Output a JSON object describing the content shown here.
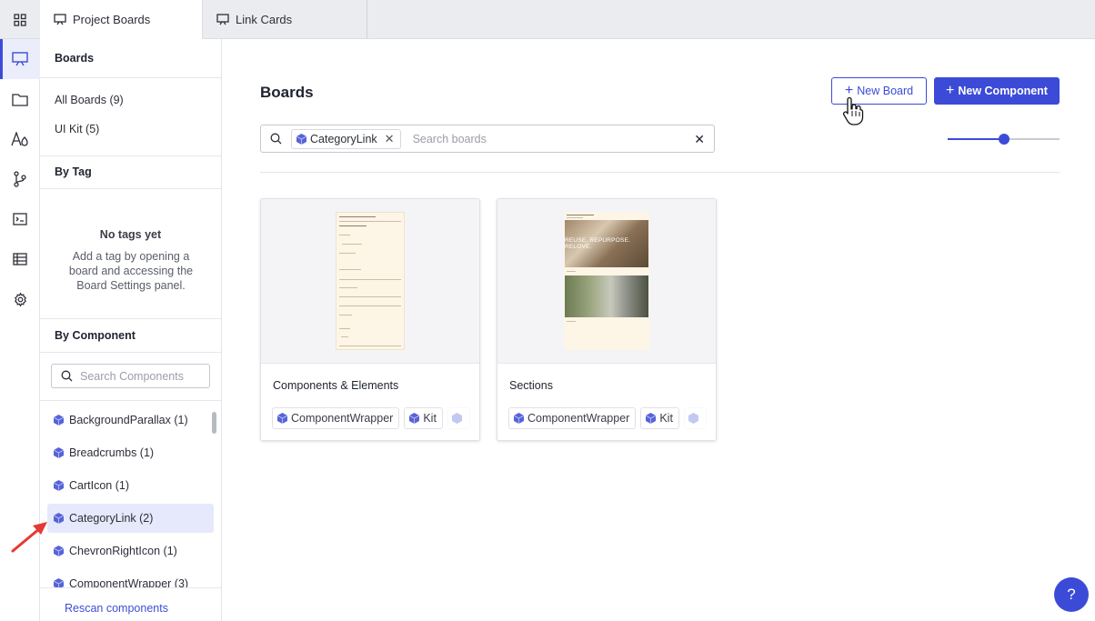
{
  "tabs": [
    {
      "label": "Project Boards",
      "active": true
    },
    {
      "label": "Link Cards",
      "active": false
    }
  ],
  "sidebar": {
    "boards_title": "Boards",
    "board_filters": [
      {
        "label": "All Boards (9)"
      },
      {
        "label": "UI Kit (5)"
      }
    ],
    "by_tag_title": "By Tag",
    "no_tags_title": "No tags yet",
    "no_tags_text": "Add a tag by opening a board and accessing the Board Settings panel.",
    "by_component_title": "By Component",
    "search_placeholder": "Search Components",
    "components": [
      {
        "label": "BackgroundParallax (1)",
        "active": false
      },
      {
        "label": "Breadcrumbs (1)",
        "active": false
      },
      {
        "label": "CartIcon (1)",
        "active": false
      },
      {
        "label": "CategoryLink (2)",
        "active": true
      },
      {
        "label": "ChevronRightIcon (1)",
        "active": false
      },
      {
        "label": "ComponentWrapper (3)",
        "active": false
      }
    ],
    "rescan_label": "Rescan components"
  },
  "main": {
    "title": "Boards",
    "new_board_label": "New Board",
    "new_component_label": "New Component",
    "filter_chip": "CategoryLink",
    "search_placeholder": "Search boards",
    "zoom_fraction": 0.5,
    "cards": [
      {
        "title": "Components & Elements",
        "tags": [
          "ComponentWrapper",
          "Kit"
        ]
      },
      {
        "title": "Sections",
        "tags": [
          "ComponentWrapper",
          "Kit"
        ],
        "preview_text": "REUSE. REPURPOSE. RELOVE."
      }
    ]
  },
  "help_label": "?",
  "colors": {
    "accent": "#3c4bd7",
    "active_bg": "#e6e9fb",
    "annotation_arrow": "#e53935"
  }
}
